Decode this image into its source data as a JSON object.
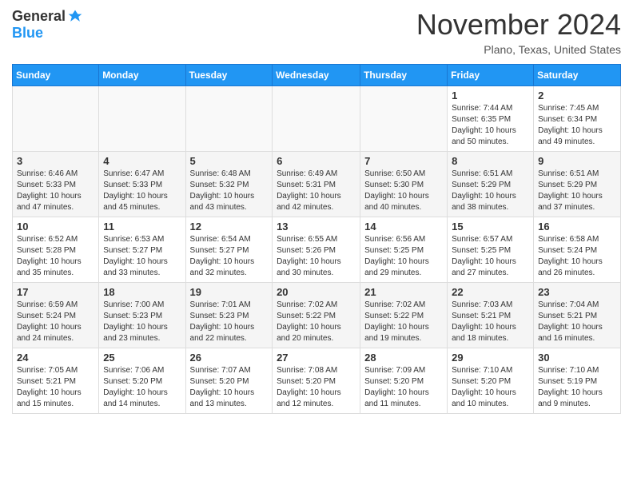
{
  "header": {
    "logo_general": "General",
    "logo_blue": "Blue",
    "month": "November 2024",
    "location": "Plano, Texas, United States"
  },
  "days_of_week": [
    "Sunday",
    "Monday",
    "Tuesday",
    "Wednesday",
    "Thursday",
    "Friday",
    "Saturday"
  ],
  "weeks": [
    [
      {
        "day": "",
        "info": ""
      },
      {
        "day": "",
        "info": ""
      },
      {
        "day": "",
        "info": ""
      },
      {
        "day": "",
        "info": ""
      },
      {
        "day": "",
        "info": ""
      },
      {
        "day": "1",
        "info": "Sunrise: 7:44 AM\nSunset: 6:35 PM\nDaylight: 10 hours\nand 50 minutes."
      },
      {
        "day": "2",
        "info": "Sunrise: 7:45 AM\nSunset: 6:34 PM\nDaylight: 10 hours\nand 49 minutes."
      }
    ],
    [
      {
        "day": "3",
        "info": "Sunrise: 6:46 AM\nSunset: 5:33 PM\nDaylight: 10 hours\nand 47 minutes."
      },
      {
        "day": "4",
        "info": "Sunrise: 6:47 AM\nSunset: 5:33 PM\nDaylight: 10 hours\nand 45 minutes."
      },
      {
        "day": "5",
        "info": "Sunrise: 6:48 AM\nSunset: 5:32 PM\nDaylight: 10 hours\nand 43 minutes."
      },
      {
        "day": "6",
        "info": "Sunrise: 6:49 AM\nSunset: 5:31 PM\nDaylight: 10 hours\nand 42 minutes."
      },
      {
        "day": "7",
        "info": "Sunrise: 6:50 AM\nSunset: 5:30 PM\nDaylight: 10 hours\nand 40 minutes."
      },
      {
        "day": "8",
        "info": "Sunrise: 6:51 AM\nSunset: 5:29 PM\nDaylight: 10 hours\nand 38 minutes."
      },
      {
        "day": "9",
        "info": "Sunrise: 6:51 AM\nSunset: 5:29 PM\nDaylight: 10 hours\nand 37 minutes."
      }
    ],
    [
      {
        "day": "10",
        "info": "Sunrise: 6:52 AM\nSunset: 5:28 PM\nDaylight: 10 hours\nand 35 minutes."
      },
      {
        "day": "11",
        "info": "Sunrise: 6:53 AM\nSunset: 5:27 PM\nDaylight: 10 hours\nand 33 minutes."
      },
      {
        "day": "12",
        "info": "Sunrise: 6:54 AM\nSunset: 5:27 PM\nDaylight: 10 hours\nand 32 minutes."
      },
      {
        "day": "13",
        "info": "Sunrise: 6:55 AM\nSunset: 5:26 PM\nDaylight: 10 hours\nand 30 minutes."
      },
      {
        "day": "14",
        "info": "Sunrise: 6:56 AM\nSunset: 5:25 PM\nDaylight: 10 hours\nand 29 minutes."
      },
      {
        "day": "15",
        "info": "Sunrise: 6:57 AM\nSunset: 5:25 PM\nDaylight: 10 hours\nand 27 minutes."
      },
      {
        "day": "16",
        "info": "Sunrise: 6:58 AM\nSunset: 5:24 PM\nDaylight: 10 hours\nand 26 minutes."
      }
    ],
    [
      {
        "day": "17",
        "info": "Sunrise: 6:59 AM\nSunset: 5:24 PM\nDaylight: 10 hours\nand 24 minutes."
      },
      {
        "day": "18",
        "info": "Sunrise: 7:00 AM\nSunset: 5:23 PM\nDaylight: 10 hours\nand 23 minutes."
      },
      {
        "day": "19",
        "info": "Sunrise: 7:01 AM\nSunset: 5:23 PM\nDaylight: 10 hours\nand 22 minutes."
      },
      {
        "day": "20",
        "info": "Sunrise: 7:02 AM\nSunset: 5:22 PM\nDaylight: 10 hours\nand 20 minutes."
      },
      {
        "day": "21",
        "info": "Sunrise: 7:02 AM\nSunset: 5:22 PM\nDaylight: 10 hours\nand 19 minutes."
      },
      {
        "day": "22",
        "info": "Sunrise: 7:03 AM\nSunset: 5:21 PM\nDaylight: 10 hours\nand 18 minutes."
      },
      {
        "day": "23",
        "info": "Sunrise: 7:04 AM\nSunset: 5:21 PM\nDaylight: 10 hours\nand 16 minutes."
      }
    ],
    [
      {
        "day": "24",
        "info": "Sunrise: 7:05 AM\nSunset: 5:21 PM\nDaylight: 10 hours\nand 15 minutes."
      },
      {
        "day": "25",
        "info": "Sunrise: 7:06 AM\nSunset: 5:20 PM\nDaylight: 10 hours\nand 14 minutes."
      },
      {
        "day": "26",
        "info": "Sunrise: 7:07 AM\nSunset: 5:20 PM\nDaylight: 10 hours\nand 13 minutes."
      },
      {
        "day": "27",
        "info": "Sunrise: 7:08 AM\nSunset: 5:20 PM\nDaylight: 10 hours\nand 12 minutes."
      },
      {
        "day": "28",
        "info": "Sunrise: 7:09 AM\nSunset: 5:20 PM\nDaylight: 10 hours\nand 11 minutes."
      },
      {
        "day": "29",
        "info": "Sunrise: 7:10 AM\nSunset: 5:20 PM\nDaylight: 10 hours\nand 10 minutes."
      },
      {
        "day": "30",
        "info": "Sunrise: 7:10 AM\nSunset: 5:19 PM\nDaylight: 10 hours\nand 9 minutes."
      }
    ]
  ]
}
